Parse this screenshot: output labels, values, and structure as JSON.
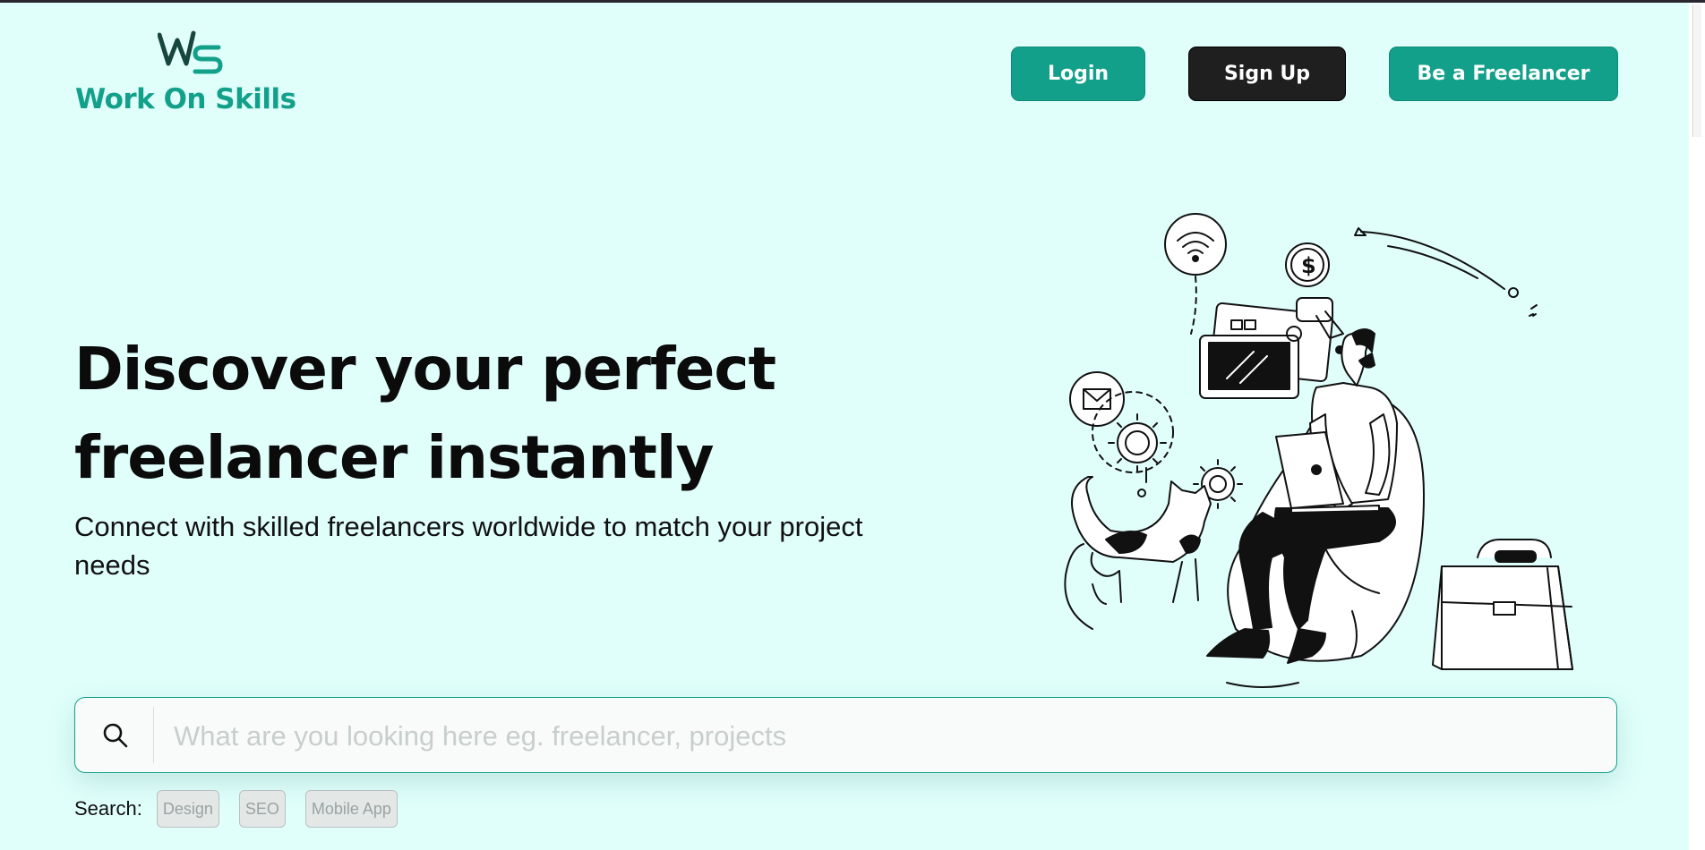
{
  "brand": {
    "name": "Work On Skills",
    "color": "#13a08b"
  },
  "nav": {
    "login_label": "Login",
    "signup_label": "Sign Up",
    "freelancer_label": "Be a Freelancer"
  },
  "hero": {
    "headline_line1": "Discover your perfect",
    "headline_line2": "freelancer instantly",
    "subhead": "Connect with skilled freelancers worldwide to match your project needs"
  },
  "search": {
    "placeholder": "What are you looking here eg. freelancer, projects",
    "value": "",
    "quick_label": "Search:",
    "tags": [
      "Design",
      "SEO",
      "Mobile App"
    ]
  },
  "icons": {
    "search": "search-icon",
    "logo": "ws-logo-mark",
    "illustration": "freelancer-on-beanbag-illustration"
  },
  "colors": {
    "background": "#e0fffb",
    "primary": "#13a08b",
    "dark_button": "#1f1f1f"
  }
}
